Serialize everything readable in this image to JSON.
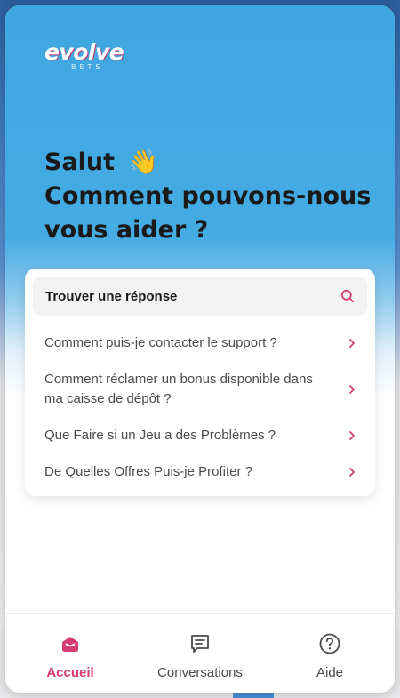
{
  "brand": {
    "name": "evolve",
    "sub": "BETS",
    "accent": "#d63c74",
    "hero_color": "#45abe3"
  },
  "greeting": {
    "line1": "Salut",
    "emoji": "👋",
    "line2": "Comment pouvons-nous vous aider ?"
  },
  "search": {
    "label": "Trouver une réponse",
    "icon": "search-icon"
  },
  "articles": [
    {
      "label": "Comment puis-je contacter le support ?"
    },
    {
      "label": "Comment réclamer un bonus disponible dans ma caisse de dépôt ?"
    },
    {
      "label": "Que Faire si un Jeu a des Problèmes ?"
    },
    {
      "label": "De Quelles Offres Puis-je Profiter ?"
    }
  ],
  "tabs": [
    {
      "label": "Accueil",
      "icon": "home-icon",
      "active": true
    },
    {
      "label": "Conversations",
      "icon": "chat-icon",
      "active": false
    },
    {
      "label": "Aide",
      "icon": "help-icon",
      "active": false
    }
  ]
}
